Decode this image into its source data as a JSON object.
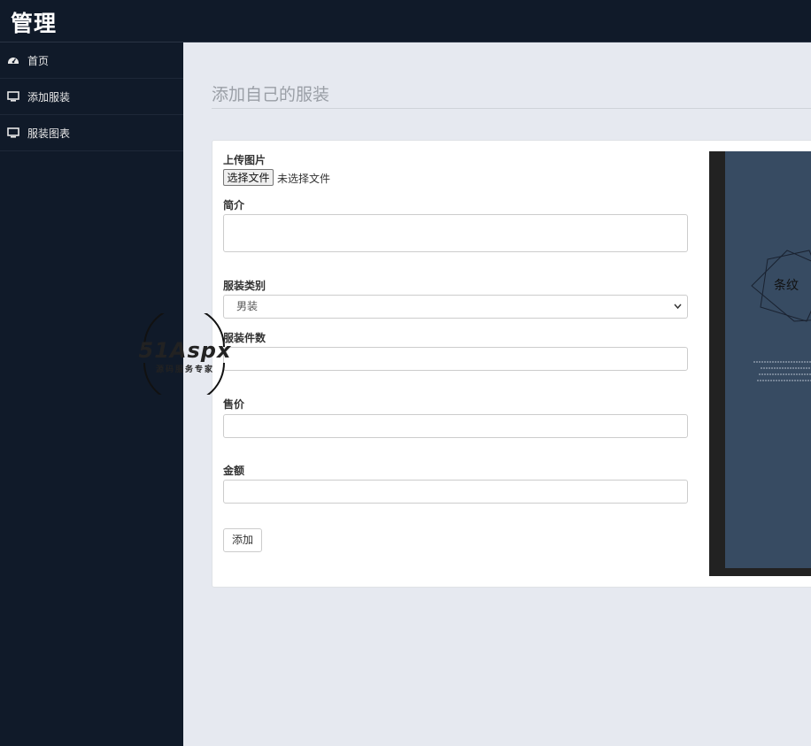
{
  "app": {
    "brand": "管理"
  },
  "sidebar": {
    "items": [
      {
        "label": "首页",
        "icon": "dashboard-icon"
      },
      {
        "label": "添加服装",
        "icon": "monitor-icon"
      },
      {
        "label": "服装图表",
        "icon": "monitor-icon"
      }
    ]
  },
  "main": {
    "page_title": "添加自己的服装",
    "form": {
      "upload": {
        "label": "上传图片",
        "button": "选择文件",
        "status": "未选择文件"
      },
      "intro": {
        "label": "简介",
        "value": ""
      },
      "category": {
        "label": "服装类别",
        "selected": "男装"
      },
      "count": {
        "label": "服装件数",
        "value": ""
      },
      "price": {
        "label": "售价",
        "value": ""
      },
      "amount": {
        "label": "金额",
        "value": ""
      },
      "submit": "添加"
    },
    "preview": {
      "text": "条纹"
    }
  },
  "watermark": {
    "brand": "51Aspx",
    "tagline": "源码服务专家"
  },
  "colors": {
    "sidebar_bg": "#101a29",
    "content_bg": "#e6e9f0",
    "preview_bg": "#374b62"
  }
}
